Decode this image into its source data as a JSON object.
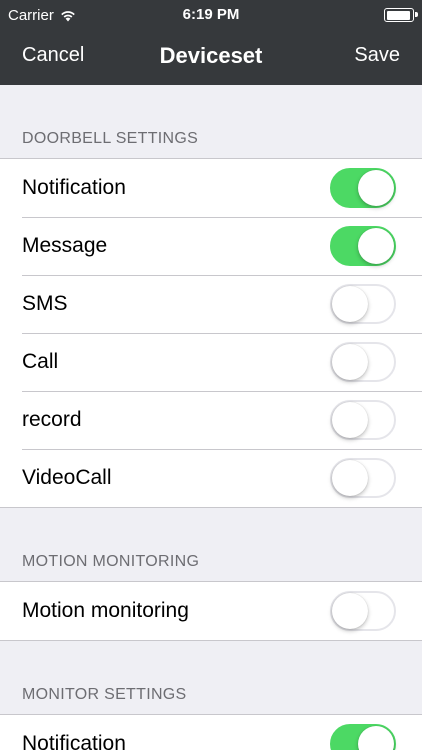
{
  "status_bar": {
    "carrier": "Carrier",
    "time": "6:19 PM"
  },
  "nav": {
    "cancel_label": "Cancel",
    "title": "Deviceset",
    "save_label": "Save"
  },
  "sections": [
    {
      "header": "DOORBELL SETTINGS",
      "rows": [
        {
          "label": "Notification",
          "on": true
        },
        {
          "label": "Message",
          "on": true
        },
        {
          "label": "SMS",
          "on": false
        },
        {
          "label": "Call",
          "on": false
        },
        {
          "label": "record",
          "on": false
        },
        {
          "label": "VideoCall",
          "on": false
        }
      ]
    },
    {
      "header": "MOTION MONITORING",
      "rows": [
        {
          "label": "Motion monitoring",
          "on": false
        }
      ]
    },
    {
      "header": "MONITOR SETTINGS",
      "rows": [
        {
          "label": "Notification",
          "on": true
        }
      ]
    }
  ],
  "colors": {
    "nav_bg": "#36393c",
    "switch_on": "#4cd964",
    "page_bg": "#efeff4"
  }
}
